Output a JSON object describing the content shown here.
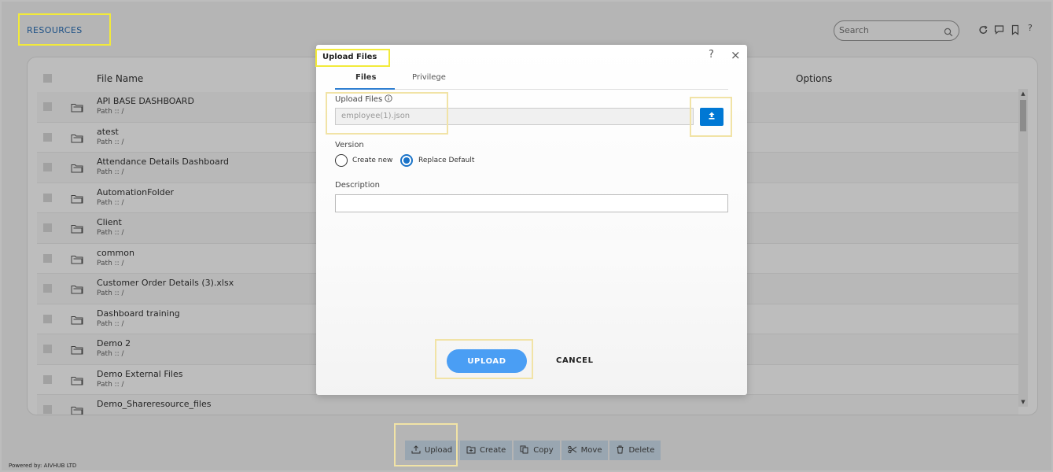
{
  "header": {
    "title": "RESOURCES",
    "search_placeholder": "Search"
  },
  "table": {
    "columns": [
      "File Name",
      "Options"
    ],
    "rows": [
      {
        "name": "API BASE DASHBOARD",
        "path": "Path :: /"
      },
      {
        "name": "atest",
        "path": "Path :: /"
      },
      {
        "name": "Attendance Details Dashboard",
        "path": "Path :: /"
      },
      {
        "name": "AutomationFolder",
        "path": "Path :: /"
      },
      {
        "name": "Client",
        "path": "Path :: /"
      },
      {
        "name": "common",
        "path": "Path :: /"
      },
      {
        "name": "Customer Order Details (3).xlsx",
        "path": "Path :: /"
      },
      {
        "name": "Dashboard training",
        "path": "Path :: /"
      },
      {
        "name": "Demo 2",
        "path": "Path :: /"
      },
      {
        "name": "Demo External Files",
        "path": "Path :: /"
      },
      {
        "name": "Demo_Shareresource_files",
        "path": ""
      }
    ]
  },
  "toolbar": {
    "upload": "Upload",
    "create": "Create",
    "copy": "Copy",
    "move": "Move",
    "delete": "Delete"
  },
  "footer": {
    "powered_by": "Powered by: AIVHUB LTD"
  },
  "dialog": {
    "title": "Upload Files",
    "help": "?",
    "close": "×",
    "tabs": [
      "Files",
      "Privilege"
    ],
    "upload_files_label": "Upload Files",
    "file_value": "employee(1).json",
    "version_label": "Version",
    "version_options": [
      "Create new",
      "Replace Default"
    ],
    "version_selected": "Replace Default",
    "description_label": "Description",
    "description_value": "",
    "upload_button": "UPLOAD",
    "cancel_button": "CANCEL"
  },
  "colors": {
    "accent": "#2a6fb6",
    "primary_button": "#4a9ef4",
    "upload_icon_button": "#0078d4",
    "highlight": "#f2ea3a",
    "toolbar": "#cfe1ef"
  }
}
